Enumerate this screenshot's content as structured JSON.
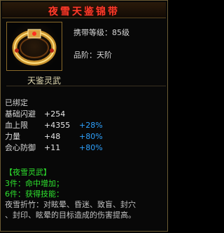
{
  "header": {
    "title": "夜雪天鉴锦带"
  },
  "item": {
    "icon": "golden-belt-icon",
    "level_text": "携带等级：85级",
    "rank_text": "品阶：天阶"
  },
  "section": {
    "title": "天鉴灵武"
  },
  "stats": {
    "bound": "已绑定",
    "rows": [
      {
        "name": "基础闪避",
        "value": "+254",
        "pct": ""
      },
      {
        "name": "血上限",
        "value": "+4355",
        "pct": "+28%"
      },
      {
        "name": "力量",
        "value": "+48",
        "pct": "+80%"
      },
      {
        "name": "会心防御",
        "value": "+11",
        "pct": "+80%"
      }
    ]
  },
  "set": {
    "title": "【夜雪灵武】",
    "line3": "3件：命中增加；",
    "line6": "6件：获得技能：",
    "skill_desc1": "夜雪折竹：对眩晕、昏迷、致盲、封穴",
    "skill_desc2": "、封印、眩晕的目标造成的伤害提高。"
  },
  "colors": {
    "title": "#ff3c2a",
    "set_green": "#2ee22e",
    "pct_blue": "#2ea2ff",
    "border": "#6b5b34"
  }
}
